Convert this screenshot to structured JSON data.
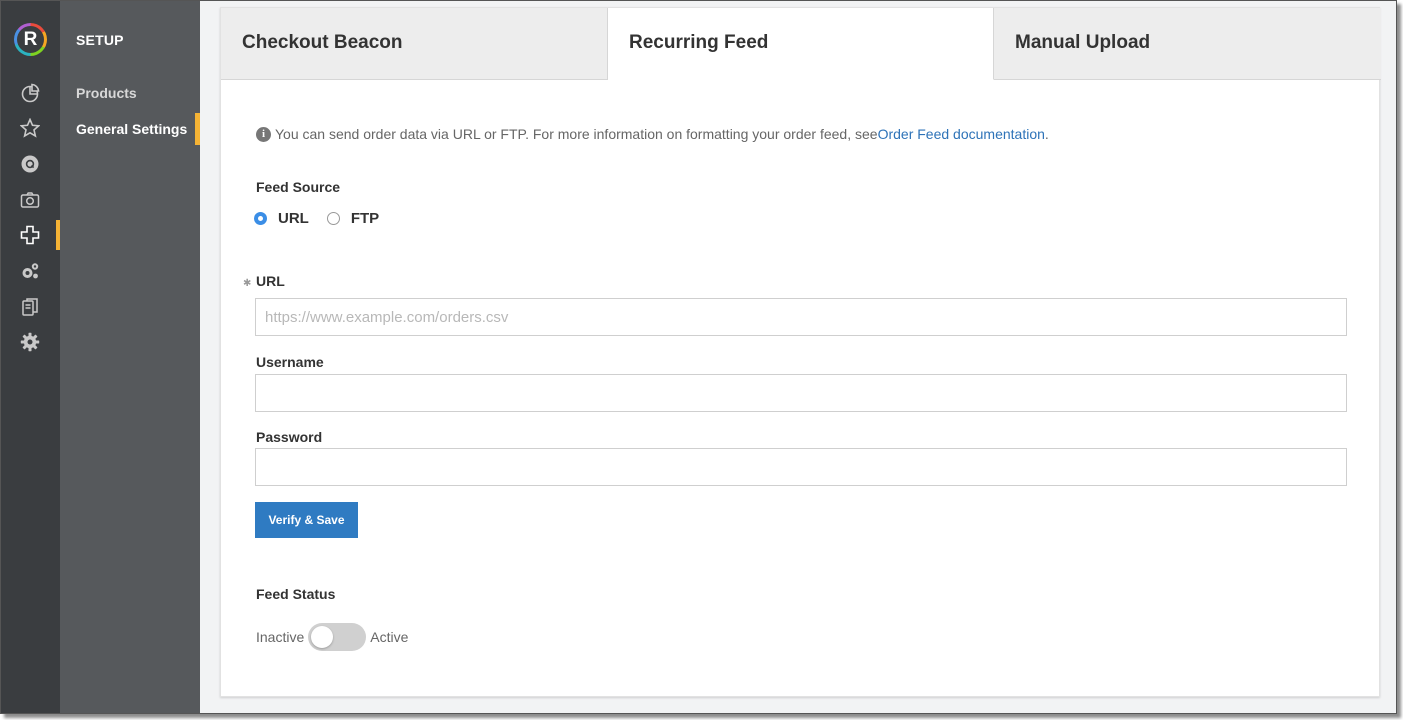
{
  "app": {
    "logo_letter": "R"
  },
  "rail": {
    "icons": [
      {
        "name": "dashboard-icon"
      },
      {
        "name": "star-icon"
      },
      {
        "name": "q-icon",
        "glyph": "Q"
      },
      {
        "name": "camera-icon"
      },
      {
        "name": "plus-icon"
      },
      {
        "name": "gears-icon"
      },
      {
        "name": "clipboard-icon"
      },
      {
        "name": "settings-gear-icon"
      }
    ],
    "accent_color": "#f5b335"
  },
  "setup_nav": {
    "title": "SETUP",
    "items": [
      {
        "label": "Products",
        "active": false
      },
      {
        "label": "General Settings",
        "active": true
      }
    ]
  },
  "tabs": [
    {
      "label": "Checkout Beacon",
      "active": false
    },
    {
      "label": "Recurring Feed",
      "active": true
    },
    {
      "label": "Manual Upload",
      "active": false
    }
  ],
  "info": {
    "text": "You can send order data via URL or FTP. For more information on formatting your order feed, see ",
    "link_text": "Order Feed documentation",
    "suffix": "."
  },
  "feed_source": {
    "label": "Feed Source",
    "options": [
      {
        "label": "URL",
        "selected": true
      },
      {
        "label": "FTP",
        "selected": false
      }
    ]
  },
  "form": {
    "url_label": "URL",
    "url_placeholder": "https://www.example.com/orders.csv",
    "url_value": "",
    "username_label": "Username",
    "username_value": "",
    "password_label": "Password",
    "password_value": "",
    "submit_label": "Verify & Save",
    "submit_color": "#2f7bc2"
  },
  "feed_status": {
    "label": "Feed Status",
    "off_label": "Inactive",
    "on_label": "Active",
    "active": false
  }
}
